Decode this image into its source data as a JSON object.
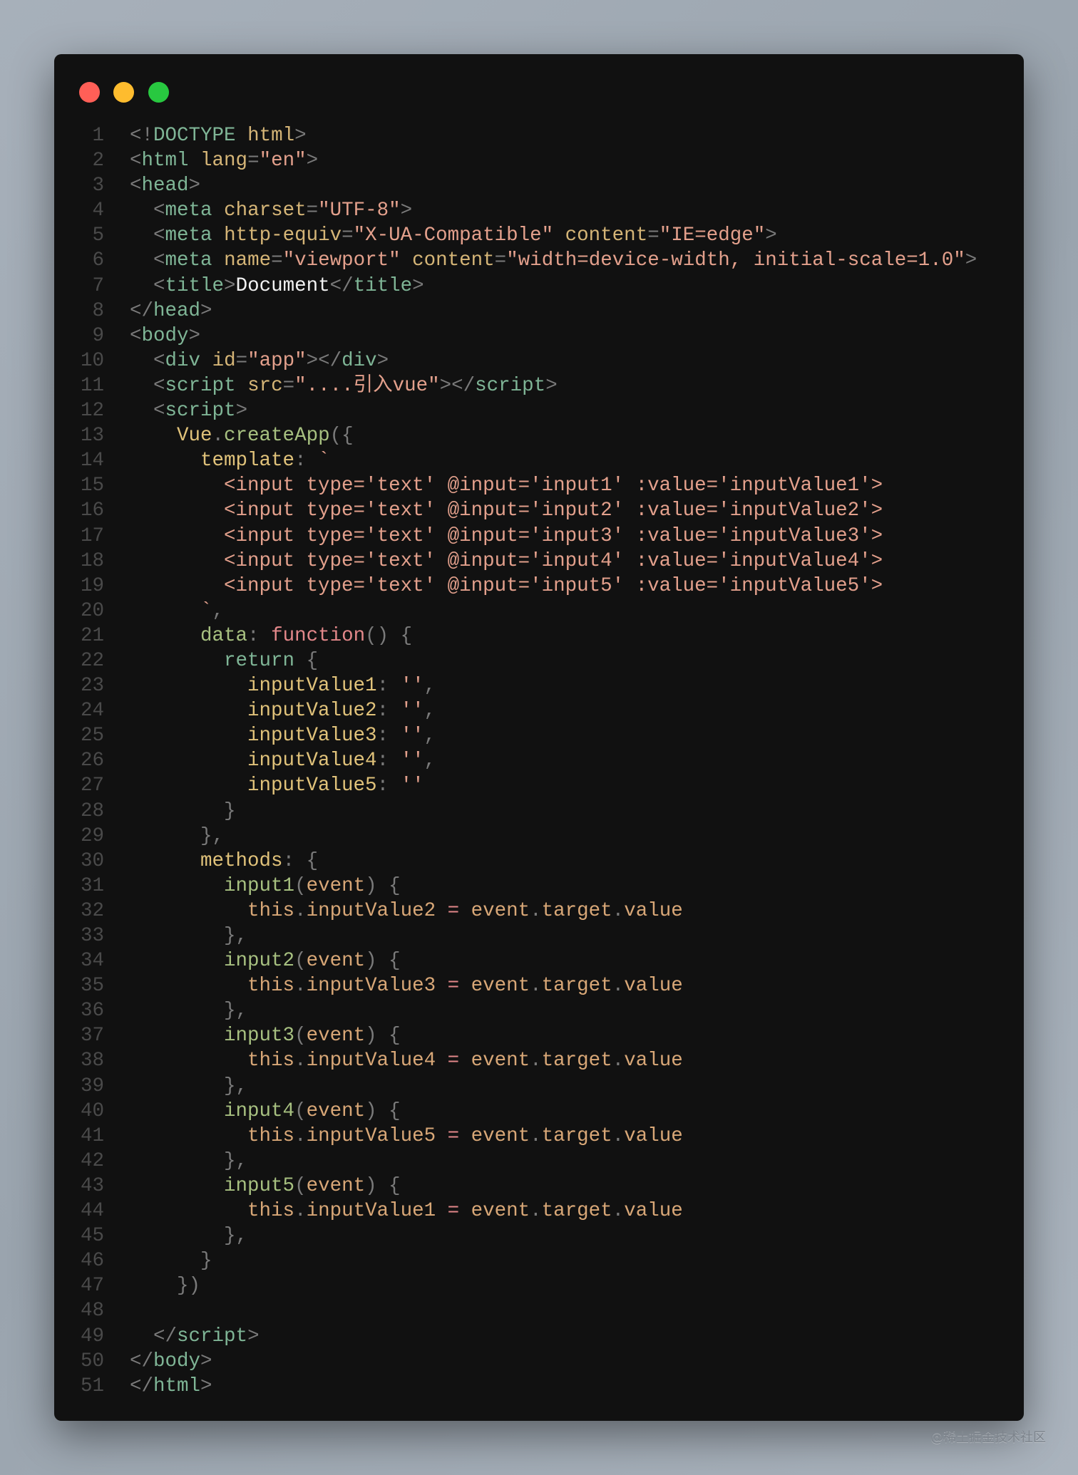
{
  "window": {
    "controls": [
      "close",
      "minimize",
      "maximize"
    ]
  },
  "watermark": "@稀土掘金技术社区",
  "lines": [
    [
      [
        "p",
        "<!"
      ],
      [
        "t",
        "DOCTYPE"
      ],
      [
        "x",
        " "
      ],
      [
        "a",
        "html"
      ],
      [
        "p",
        ">"
      ]
    ],
    [
      [
        "p",
        "<"
      ],
      [
        "t",
        "html"
      ],
      [
        "x",
        " "
      ],
      [
        "a",
        "lang"
      ],
      [
        "p",
        "="
      ],
      [
        "s",
        "\"en\""
      ],
      [
        "p",
        ">"
      ]
    ],
    [
      [
        "p",
        "<"
      ],
      [
        "t",
        "head"
      ],
      [
        "p",
        ">"
      ]
    ],
    [
      [
        "x",
        "  "
      ],
      [
        "p",
        "<"
      ],
      [
        "t",
        "meta"
      ],
      [
        "x",
        " "
      ],
      [
        "a",
        "charset"
      ],
      [
        "p",
        "="
      ],
      [
        "s",
        "\"UTF-8\""
      ],
      [
        "p",
        ">"
      ]
    ],
    [
      [
        "x",
        "  "
      ],
      [
        "p",
        "<"
      ],
      [
        "t",
        "meta"
      ],
      [
        "x",
        " "
      ],
      [
        "a",
        "http-equiv"
      ],
      [
        "p",
        "="
      ],
      [
        "s",
        "\"X-UA-Compatible\""
      ],
      [
        "x",
        " "
      ],
      [
        "a",
        "content"
      ],
      [
        "p",
        "="
      ],
      [
        "s",
        "\"IE=edge\""
      ],
      [
        "p",
        ">"
      ]
    ],
    [
      [
        "x",
        "  "
      ],
      [
        "p",
        "<"
      ],
      [
        "t",
        "meta"
      ],
      [
        "x",
        " "
      ],
      [
        "a",
        "name"
      ],
      [
        "p",
        "="
      ],
      [
        "s",
        "\"viewport\""
      ],
      [
        "x",
        " "
      ],
      [
        "a",
        "content"
      ],
      [
        "p",
        "="
      ],
      [
        "s",
        "\"width=device-width, initial-scale=1.0\""
      ],
      [
        "p",
        ">"
      ]
    ],
    [
      [
        "x",
        "  "
      ],
      [
        "p",
        "<"
      ],
      [
        "t",
        "title"
      ],
      [
        "p",
        ">"
      ],
      [
        "x",
        "Document"
      ],
      [
        "p",
        "</"
      ],
      [
        "t",
        "title"
      ],
      [
        "p",
        ">"
      ]
    ],
    [
      [
        "p",
        "</"
      ],
      [
        "t",
        "head"
      ],
      [
        "p",
        ">"
      ]
    ],
    [
      [
        "p",
        "<"
      ],
      [
        "t",
        "body"
      ],
      [
        "p",
        ">"
      ]
    ],
    [
      [
        "x",
        "  "
      ],
      [
        "p",
        "<"
      ],
      [
        "t",
        "div"
      ],
      [
        "x",
        " "
      ],
      [
        "a",
        "id"
      ],
      [
        "p",
        "="
      ],
      [
        "s",
        "\"app\""
      ],
      [
        "p",
        "></"
      ],
      [
        "t",
        "div"
      ],
      [
        "p",
        ">"
      ]
    ],
    [
      [
        "x",
        "  "
      ],
      [
        "p",
        "<"
      ],
      [
        "t",
        "script"
      ],
      [
        "x",
        " "
      ],
      [
        "a",
        "src"
      ],
      [
        "p",
        "="
      ],
      [
        "s",
        "\"....引入vue\""
      ],
      [
        "p",
        "></"
      ],
      [
        "t",
        "script"
      ],
      [
        "p",
        ">"
      ]
    ],
    [
      [
        "x",
        "  "
      ],
      [
        "p",
        "<"
      ],
      [
        "t",
        "script"
      ],
      [
        "p",
        ">"
      ]
    ],
    [
      [
        "x",
        "    "
      ],
      [
        "y",
        "Vue"
      ],
      [
        "p",
        "."
      ],
      [
        "f",
        "createApp"
      ],
      [
        "p",
        "({"
      ]
    ],
    [
      [
        "x",
        "      "
      ],
      [
        "y",
        "template"
      ],
      [
        "p",
        ": "
      ],
      [
        "s",
        "`"
      ]
    ],
    [
      [
        "x",
        "        "
      ],
      [
        "s",
        "<input type='text' @input='input1' :value='inputValue1'>"
      ]
    ],
    [
      [
        "x",
        "        "
      ],
      [
        "s",
        "<input type='text' @input='input2' :value='inputValue2'>"
      ]
    ],
    [
      [
        "x",
        "        "
      ],
      [
        "s",
        "<input type='text' @input='input3' :value='inputValue3'>"
      ]
    ],
    [
      [
        "x",
        "        "
      ],
      [
        "s",
        "<input type='text' @input='input4' :value='inputValue4'>"
      ]
    ],
    [
      [
        "x",
        "        "
      ],
      [
        "s",
        "<input type='text' @input='input5' :value='inputValue5'>"
      ]
    ],
    [
      [
        "x",
        "      "
      ],
      [
        "s",
        "`"
      ],
      [
        "p",
        ","
      ]
    ],
    [
      [
        "x",
        "      "
      ],
      [
        "f",
        "data"
      ],
      [
        "p",
        ": "
      ],
      [
        "k",
        "function"
      ],
      [
        "p",
        "() {"
      ]
    ],
    [
      [
        "x",
        "        "
      ],
      [
        "t",
        "return"
      ],
      [
        "p",
        " {"
      ]
    ],
    [
      [
        "x",
        "          "
      ],
      [
        "y",
        "inputValue1"
      ],
      [
        "p",
        ": "
      ],
      [
        "s",
        "''"
      ],
      [
        "p",
        ","
      ]
    ],
    [
      [
        "x",
        "          "
      ],
      [
        "y",
        "inputValue2"
      ],
      [
        "p",
        ": "
      ],
      [
        "s",
        "''"
      ],
      [
        "p",
        ","
      ]
    ],
    [
      [
        "x",
        "          "
      ],
      [
        "y",
        "inputValue3"
      ],
      [
        "p",
        ": "
      ],
      [
        "s",
        "''"
      ],
      [
        "p",
        ","
      ]
    ],
    [
      [
        "x",
        "          "
      ],
      [
        "y",
        "inputValue4"
      ],
      [
        "p",
        ": "
      ],
      [
        "s",
        "''"
      ],
      [
        "p",
        ","
      ]
    ],
    [
      [
        "x",
        "          "
      ],
      [
        "y",
        "inputValue5"
      ],
      [
        "p",
        ": "
      ],
      [
        "s",
        "''"
      ]
    ],
    [
      [
        "x",
        "        "
      ],
      [
        "p",
        "}"
      ]
    ],
    [
      [
        "x",
        "      "
      ],
      [
        "p",
        "},"
      ]
    ],
    [
      [
        "x",
        "      "
      ],
      [
        "y",
        "methods"
      ],
      [
        "p",
        ": {"
      ]
    ],
    [
      [
        "x",
        "        "
      ],
      [
        "f",
        "input1"
      ],
      [
        "p",
        "("
      ],
      [
        "v",
        "event"
      ],
      [
        "p",
        ") {"
      ]
    ],
    [
      [
        "x",
        "          "
      ],
      [
        "v",
        "this"
      ],
      [
        "p",
        "."
      ],
      [
        "v",
        "inputValue2"
      ],
      [
        "k",
        " = "
      ],
      [
        "v",
        "event"
      ],
      [
        "p",
        "."
      ],
      [
        "v",
        "target"
      ],
      [
        "p",
        "."
      ],
      [
        "v",
        "value"
      ]
    ],
    [
      [
        "x",
        "        "
      ],
      [
        "p",
        "},"
      ]
    ],
    [
      [
        "x",
        "        "
      ],
      [
        "f",
        "input2"
      ],
      [
        "p",
        "("
      ],
      [
        "v",
        "event"
      ],
      [
        "p",
        ") {"
      ]
    ],
    [
      [
        "x",
        "          "
      ],
      [
        "v",
        "this"
      ],
      [
        "p",
        "."
      ],
      [
        "v",
        "inputValue3"
      ],
      [
        "k",
        " = "
      ],
      [
        "v",
        "event"
      ],
      [
        "p",
        "."
      ],
      [
        "v",
        "target"
      ],
      [
        "p",
        "."
      ],
      [
        "v",
        "value"
      ]
    ],
    [
      [
        "x",
        "        "
      ],
      [
        "p",
        "},"
      ]
    ],
    [
      [
        "x",
        "        "
      ],
      [
        "f",
        "input3"
      ],
      [
        "p",
        "("
      ],
      [
        "v",
        "event"
      ],
      [
        "p",
        ") {"
      ]
    ],
    [
      [
        "x",
        "          "
      ],
      [
        "v",
        "this"
      ],
      [
        "p",
        "."
      ],
      [
        "v",
        "inputValue4"
      ],
      [
        "k",
        " = "
      ],
      [
        "v",
        "event"
      ],
      [
        "p",
        "."
      ],
      [
        "v",
        "target"
      ],
      [
        "p",
        "."
      ],
      [
        "v",
        "value"
      ]
    ],
    [
      [
        "x",
        "        "
      ],
      [
        "p",
        "},"
      ]
    ],
    [
      [
        "x",
        "        "
      ],
      [
        "f",
        "input4"
      ],
      [
        "p",
        "("
      ],
      [
        "v",
        "event"
      ],
      [
        "p",
        ") {"
      ]
    ],
    [
      [
        "x",
        "          "
      ],
      [
        "v",
        "this"
      ],
      [
        "p",
        "."
      ],
      [
        "v",
        "inputValue5"
      ],
      [
        "k",
        " = "
      ],
      [
        "v",
        "event"
      ],
      [
        "p",
        "."
      ],
      [
        "v",
        "target"
      ],
      [
        "p",
        "."
      ],
      [
        "v",
        "value"
      ]
    ],
    [
      [
        "x",
        "        "
      ],
      [
        "p",
        "},"
      ]
    ],
    [
      [
        "x",
        "        "
      ],
      [
        "f",
        "input5"
      ],
      [
        "p",
        "("
      ],
      [
        "v",
        "event"
      ],
      [
        "p",
        ") {"
      ]
    ],
    [
      [
        "x",
        "          "
      ],
      [
        "v",
        "this"
      ],
      [
        "p",
        "."
      ],
      [
        "v",
        "inputValue1"
      ],
      [
        "k",
        " = "
      ],
      [
        "v",
        "event"
      ],
      [
        "p",
        "."
      ],
      [
        "v",
        "target"
      ],
      [
        "p",
        "."
      ],
      [
        "v",
        "value"
      ]
    ],
    [
      [
        "x",
        "        "
      ],
      [
        "p",
        "},"
      ]
    ],
    [
      [
        "x",
        "      "
      ],
      [
        "p",
        "}"
      ]
    ],
    [
      [
        "x",
        "    "
      ],
      [
        "p",
        "})"
      ]
    ],
    [],
    [
      [
        "x",
        "  "
      ],
      [
        "p",
        "</"
      ],
      [
        "t",
        "script"
      ],
      [
        "p",
        ">"
      ]
    ],
    [
      [
        "p",
        "</"
      ],
      [
        "t",
        "body"
      ],
      [
        "p",
        ">"
      ]
    ],
    [
      [
        "p",
        "</"
      ],
      [
        "t",
        "html"
      ],
      [
        "p",
        ">"
      ]
    ]
  ]
}
